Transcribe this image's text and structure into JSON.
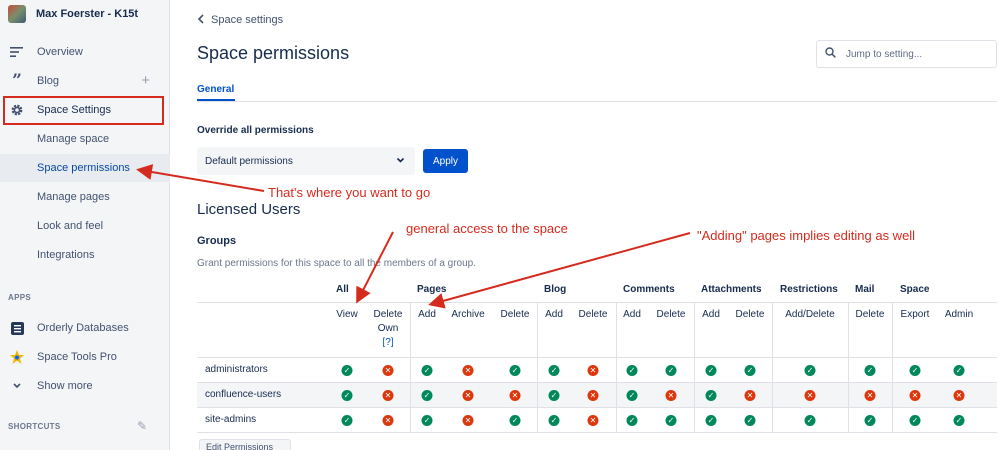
{
  "space": {
    "name": "Max Foerster - K15t"
  },
  "sidebar": {
    "items": [
      {
        "label": "Overview",
        "icon": "overview-lines-icon"
      },
      {
        "label": "Blog",
        "icon": "quote-icon"
      },
      {
        "label": "Space Settings",
        "icon": "gear-icon"
      }
    ],
    "sub_items": [
      "Manage space",
      "Space permissions",
      "Manage pages",
      "Look and feel",
      "Integrations"
    ],
    "apps_label": "APPS",
    "apps": [
      {
        "label": "Orderly Databases",
        "icon": "database-icon"
      },
      {
        "label": "Space Tools Pro",
        "icon": "star-tool-icon"
      },
      {
        "label": "Show more",
        "icon": "chevron-down-icon"
      }
    ],
    "shortcuts_label": "SHORTCUTS"
  },
  "breadcrumb": "Space settings",
  "title": "Space permissions",
  "search": {
    "placeholder": "Jump to setting..."
  },
  "tabs": [
    "General"
  ],
  "override": {
    "label": "Override all permissions",
    "select_value": "Default permissions",
    "apply_label": "Apply"
  },
  "licensed_heading": "Licensed Users",
  "groups": {
    "heading": "Groups",
    "description": "Grant permissions for this space to all the members of a group.",
    "categories": [
      "All",
      "Pages",
      "Blog",
      "Comments",
      "Attachments",
      "Restrictions",
      "Mail",
      "Space"
    ],
    "columns": [
      "View",
      "Delete Own",
      "Add",
      "Archive",
      "Delete",
      "Add",
      "Delete",
      "Add",
      "Delete",
      "Add",
      "Delete",
      "Add/Delete",
      "Delete",
      "Export",
      "Admin"
    ],
    "delete_own_line1": "Delete",
    "delete_own_line2": "Own",
    "help_link": "[?]",
    "rows": [
      {
        "name": "administrators",
        "perms": [
          1,
          0,
          1,
          0,
          1,
          1,
          0,
          1,
          1,
          1,
          1,
          1,
          1,
          1,
          1
        ]
      },
      {
        "name": "confluence-users",
        "perms": [
          1,
          0,
          1,
          0,
          0,
          1,
          0,
          1,
          0,
          1,
          0,
          0,
          0,
          0,
          0
        ]
      },
      {
        "name": "site-admins",
        "perms": [
          1,
          0,
          1,
          0,
          1,
          1,
          0,
          1,
          1,
          1,
          1,
          1,
          1,
          1,
          1
        ]
      }
    ],
    "edit_button": "Edit Permissions"
  },
  "annotations": {
    "where_to_go": "That's where you want to go",
    "general_access": "general access to the space",
    "adding_pages": "\"Adding\" pages implies editing as well"
  },
  "colors": {
    "accent": "#0052cc",
    "annotation": "#d52b1e",
    "granted": "#00875a",
    "denied": "#de350b"
  }
}
